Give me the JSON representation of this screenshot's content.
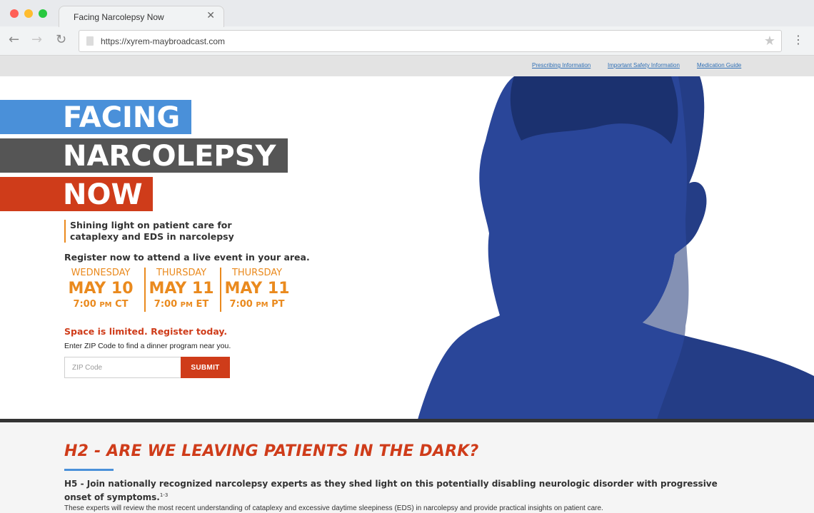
{
  "browser": {
    "tab_title": "Facing Narcolepsy Now",
    "tab_close": "✕",
    "url": "https://xyrem-maybroadcast.com",
    "back_icon": "←",
    "forward_icon": "→",
    "reload_icon": "↻",
    "star_icon": "★",
    "menu_icon": "⋮"
  },
  "utility_links": [
    "Prescribing Information",
    "Important Safety Information",
    "Medication Guide"
  ],
  "hero": {
    "title_lines": [
      "FACING",
      "NARCOLEPSY",
      "NOW"
    ],
    "tagline": "Shining light on patient care for cataplexy and EDS in narcolepsy",
    "register_text": "Register now to attend a live event in your area.",
    "events": [
      {
        "day": "WEDNESDAY",
        "date": "MAY 10",
        "time": "7:00",
        "ampm": "PM",
        "tz": "CT"
      },
      {
        "day": "THURSDAY",
        "date": "MAY 11",
        "time": "7:00",
        "ampm": "PM",
        "tz": "ET"
      },
      {
        "day": "THURSDAY",
        "date": "MAY 11",
        "time": "7:00",
        "ampm": "PM",
        "tz": "PT"
      }
    ],
    "limited_text": "Space is limited. Register today.",
    "zip_prompt": "Enter ZIP Code to find a dinner program near you.",
    "zip_placeholder": "ZIP Code",
    "submit_label": "SUBMIT"
  },
  "colors": {
    "blue": "#4a90d9",
    "gray": "#555555",
    "orange_red": "#cf3c1a",
    "orange": "#ea8a1e",
    "photo_blue": "#2a4699"
  },
  "section": {
    "h2": "H2 - ARE WE LEAVING PATIENTS IN THE DARK?",
    "h5": "H5 - Join nationally recognized narcolepsy experts as they shed light on this potentially disabling neurologic disorder with progressive onset of symptoms.",
    "h5_sup": "1-3",
    "body": "These experts will review the most recent understanding of cataplexy and excessive daytime sleepiness (EDS) in narcolepsy and provide practical insights on patient care."
  }
}
